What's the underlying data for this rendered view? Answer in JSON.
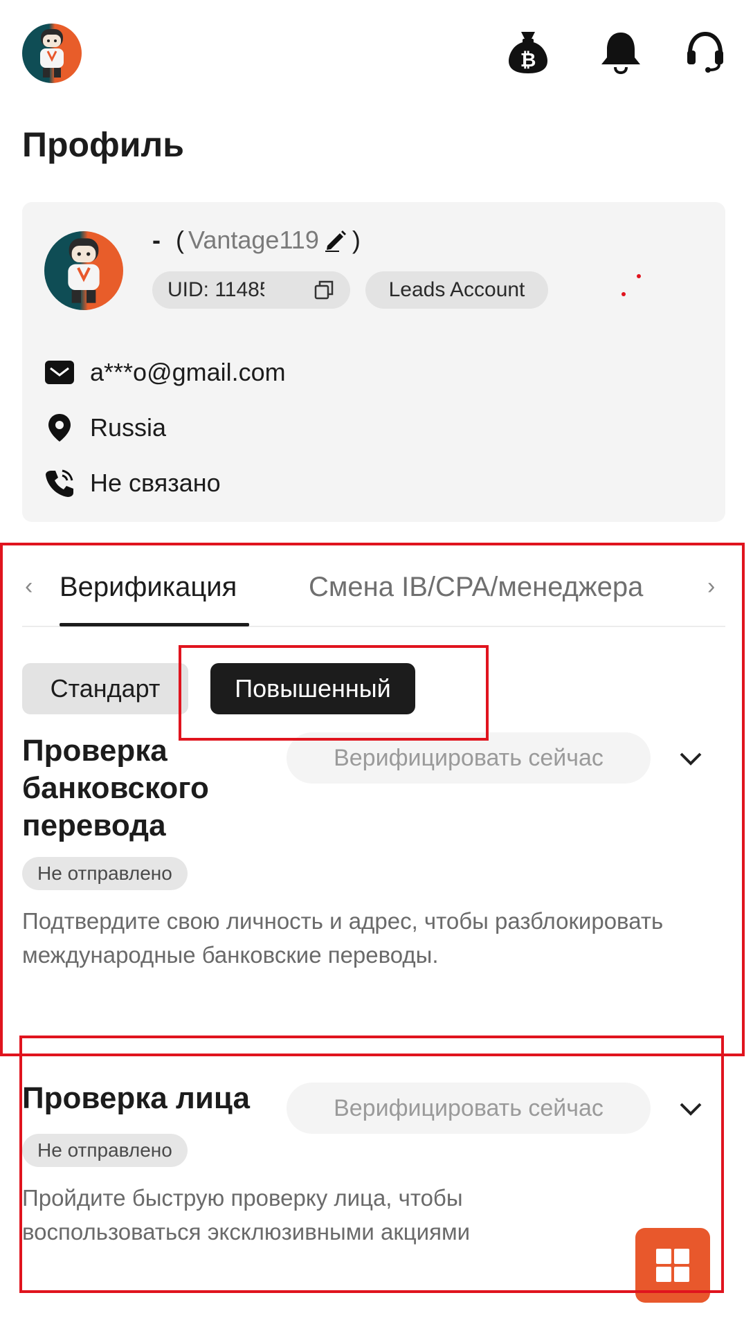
{
  "header": {
    "page_title": "Профиль"
  },
  "profile": {
    "name": "-",
    "username_open": "(",
    "username": "Vantage119",
    "username_close": ")",
    "uid_label": "UID: 11485",
    "account_type": "Leads Account",
    "email": "a***o@gmail.com",
    "country": "Russia",
    "phone": "Не связано"
  },
  "tabs": {
    "items": [
      {
        "label": "Верификация",
        "active": true
      },
      {
        "label": "Смена IB/CPA/менеджера",
        "active": false
      }
    ]
  },
  "levels": {
    "standard": "Стандарт",
    "advanced": "Повышенный",
    "selected": "Повышенный"
  },
  "sections": [
    {
      "title": "Проверка банковского перевода",
      "title_lines": [
        "Проверка",
        "банковского",
        "перевода"
      ],
      "action": "Верифицировать сейчас",
      "status": "Не отправлено",
      "description": "Подтвердите свою личность и адрес, чтобы разблокировать международные банковские переводы."
    },
    {
      "title": "Проверка лица",
      "action": "Верифицировать сейчас",
      "status": "Не отправлено",
      "description": "Пройдите быструю проверку лица, чтобы воспользоваться эксклюзивными акциями"
    }
  ],
  "icons": {
    "crypto_wallet": "bitcoin-bag-icon",
    "notifications": "bell-icon",
    "support": "headset-icon",
    "edit": "pencil-icon",
    "copy": "copy-icon",
    "email": "mail-icon",
    "location": "location-pin-icon",
    "phone": "phone-icon",
    "chevron": "chevron-down-icon",
    "apps": "grid-icon"
  },
  "colors": {
    "accent": "#e8582c",
    "annotation": "#e0141e",
    "dark": "#1c1c1c"
  }
}
